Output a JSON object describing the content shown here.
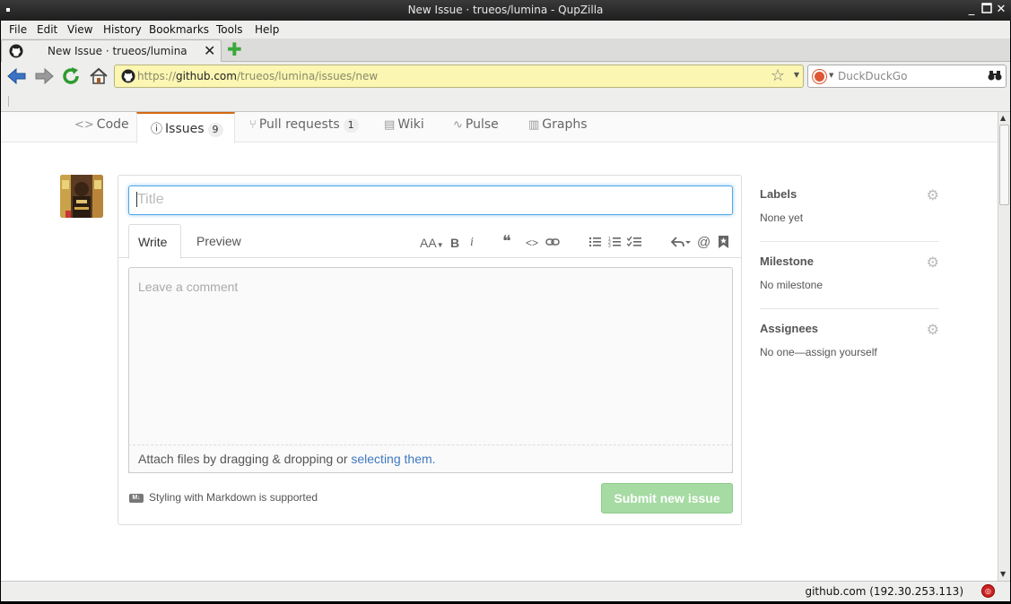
{
  "window": {
    "title": "New Issue · trueos/lumina - QupZilla"
  },
  "menu": {
    "items": [
      "File",
      "Edit",
      "View",
      "History",
      "Bookmarks",
      "Tools",
      "Help"
    ]
  },
  "tabs": [
    {
      "label": "New Issue · trueos/lumina",
      "icon": "github-icon"
    }
  ],
  "navbar": {
    "url_prefix": "https://",
    "url_domain": "github.com",
    "url_path": "/trueos/lumina/issues/new",
    "search_placeholder": "DuckDuckGo"
  },
  "repo_nav": {
    "code": "Code",
    "issues": "Issues",
    "issues_count": "9",
    "pulls": "Pull requests",
    "pulls_count": "1",
    "wiki": "Wiki",
    "pulse": "Pulse",
    "graphs": "Graphs"
  },
  "form": {
    "title_placeholder": "Title",
    "write_tab": "Write",
    "preview_tab": "Preview",
    "comment_placeholder": "Leave a comment",
    "attach_text": "Attach files by dragging & dropping or ",
    "attach_link": "selecting them.",
    "markdown_note": "Styling with Markdown is supported",
    "markdown_icon_text": "M↓",
    "submit_label": "Submit new issue"
  },
  "toolbar": {
    "header": "AA",
    "bold": "B",
    "italic": "i",
    "quote": "❝",
    "code": "<>",
    "mention": "@"
  },
  "sidebar": {
    "labels_heading": "Labels",
    "labels_value": "None yet",
    "milestone_heading": "Milestone",
    "milestone_value": "No milestone",
    "assignees_heading": "Assignees",
    "assignees_value": "No one—assign yourself"
  },
  "status": {
    "text": "github.com (192.30.253.113)"
  },
  "colors": {
    "url_bar_bg": "#fbf6b2",
    "submit_bg": "#a6dba3",
    "link": "#4078c0",
    "focus": "#51a7e8",
    "selected_tab_accent": "#d26911"
  }
}
